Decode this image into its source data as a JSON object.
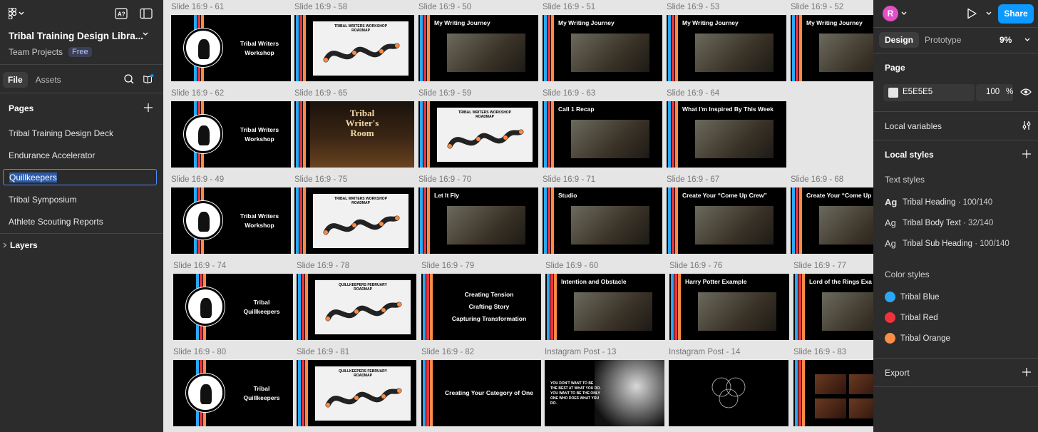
{
  "left_panel": {
    "file_title": "Tribal Training Design Libra...",
    "team": "Team Projects",
    "plan_badge": "Free",
    "tabs": [
      "File",
      "Assets"
    ],
    "pages_heading": "Pages",
    "pages": [
      "Tribal Training Design Deck",
      "Endurance Accelerator",
      "Quillkeepers",
      "Tribal Symposium",
      "Athlete Scouting Reports"
    ],
    "editing_page_index": 2,
    "layers_heading": "Layers"
  },
  "canvas": {
    "rows": [
      [
        {
          "label": "Slide 16:9 - 61",
          "kind": "logo",
          "text": [
            "Tribal Writers",
            "Workshop"
          ]
        },
        {
          "label": "Slide 16:9 - 58",
          "kind": "roadmap",
          "text": [
            "TRIBAL WRITERS WORKSHOP",
            "ROADMAP"
          ]
        },
        {
          "label": "Slide 16:9 - 50",
          "kind": "titled",
          "title": "My Writing Journey"
        },
        {
          "label": "Slide 16:9 - 51",
          "kind": "titled",
          "title": "My Writing Journey"
        },
        {
          "label": "Slide 16:9 - 53",
          "kind": "titled",
          "title": "My Writing Journey"
        },
        {
          "label": "Slide 16:9 - 52",
          "kind": "titled",
          "title": "My Writing Journey"
        }
      ],
      [
        {
          "label": "Slide 16:9 - 62",
          "kind": "logo",
          "text": [
            "Tribal Writers",
            "Workshop"
          ]
        },
        {
          "label": "Slide 16:9 - 65",
          "kind": "room",
          "text": [
            "Tribal",
            "Writer's",
            "Room"
          ]
        },
        {
          "label": "Slide 16:9 - 59",
          "kind": "roadmap",
          "text": [
            "TRIBAL WRITERS WORKSHOP",
            "ROADMAP"
          ]
        },
        {
          "label": "Slide 16:9 - 63",
          "kind": "titled",
          "title": "Call 1 Recap"
        },
        {
          "label": "Slide 16:9 - 64",
          "kind": "titled",
          "title": "What I'm Inspired By This Week"
        }
      ],
      [
        {
          "label": "Slide 16:9 - 49",
          "kind": "logo",
          "text": [
            "Tribal Writers",
            "Workshop"
          ]
        },
        {
          "label": "Slide 16:9 - 75",
          "kind": "roadmap",
          "text": [
            "TRIBAL WRITERS WORKSHOP",
            "ROADMAP"
          ]
        },
        {
          "label": "Slide 16:9 - 70",
          "kind": "titled",
          "title": "Let It Fly"
        },
        {
          "label": "Slide 16:9 - 71",
          "kind": "titled",
          "title": "Studio"
        },
        {
          "label": "Slide 16:9 - 67",
          "kind": "titled",
          "title": "Create Your “Come Up Crew”"
        },
        {
          "label": "Slide 16:9 - 68",
          "kind": "titled",
          "title": "Create Your “Come Up"
        }
      ],
      [
        {
          "label": "Slide 16:9 - 74",
          "kind": "logo",
          "text": [
            "Tribal",
            "Quillkeepers"
          ]
        },
        {
          "label": "Slide 16:9 - 78",
          "kind": "roadmap",
          "text": [
            "QUILLKEEPERS FEBRUARY",
            "ROADMAP"
          ]
        },
        {
          "label": "Slide 16:9 - 79",
          "kind": "center",
          "text": [
            "Creating Tension",
            "Crafting Story",
            "Capturing Transformation"
          ]
        },
        {
          "label": "Slide 16:9 - 60",
          "kind": "titled",
          "title": "Intention and Obstacle"
        },
        {
          "label": "Slide 16:9 - 76",
          "kind": "titled",
          "title": "Harry Potter Example"
        },
        {
          "label": "Slide 16:9 - 77",
          "kind": "titled",
          "title": "Lord of the Rings Exa"
        }
      ],
      [
        {
          "label": "Slide 16:9 - 80",
          "kind": "logo",
          "text": [
            "Tribal",
            "Quillkeepers"
          ]
        },
        {
          "label": "Slide 16:9 - 81",
          "kind": "roadmap",
          "text": [
            "QUILLKEEPERS FEBRUARY",
            "ROADMAP"
          ]
        },
        {
          "label": "Slide 16:9 - 82",
          "kind": "center",
          "text": [
            "Creating Your Category of One"
          ]
        },
        {
          "label": "Instagram Post - 13",
          "kind": "quote",
          "text": [
            "YOU DON'T WANT TO BE",
            "THE BEST AT WHAT YOU DO.",
            "YOU WANT TO BE THE ONLY",
            "ONE WHO DOES WHAT YOU",
            "DO."
          ]
        },
        {
          "label": "Instagram Post - 14",
          "kind": "circles"
        },
        {
          "label": "Slide 16:9 - 83",
          "kind": "photos"
        }
      ]
    ]
  },
  "right_panel": {
    "avatar_letter": "R",
    "share_label": "Share",
    "tabs": [
      "Design",
      "Prototype"
    ],
    "zoom": "9%",
    "page_heading": "Page",
    "page_color": "E5E5E5",
    "page_opacity": "100",
    "percent_sign": "%",
    "local_variables": "Local variables",
    "local_styles": "Local styles",
    "text_styles_heading": "Text styles",
    "text_styles": [
      {
        "glyph": "Ag",
        "name": "Tribal Heading",
        "meta": " · 100/140"
      },
      {
        "glyph": "Ag",
        "name": "Tribal Body Text",
        "meta": " · 32/140"
      },
      {
        "glyph": "Ag",
        "name": "Tribal Sub Heading",
        "meta": " · 100/140"
      }
    ],
    "color_styles_heading": "Color styles",
    "color_styles": [
      {
        "name": "Tribal Blue",
        "color": "#2aa8f5"
      },
      {
        "name": "Tribal Red",
        "color": "#f0333a"
      },
      {
        "name": "Tribal Orange",
        "color": "#f98c46"
      }
    ],
    "export_heading": "Export"
  },
  "colors": {
    "stripe_blue": "#2aa8f5",
    "stripe_red": "#f0333a",
    "stripe_orange": "#f98c46",
    "accent": "#0d99ff"
  }
}
